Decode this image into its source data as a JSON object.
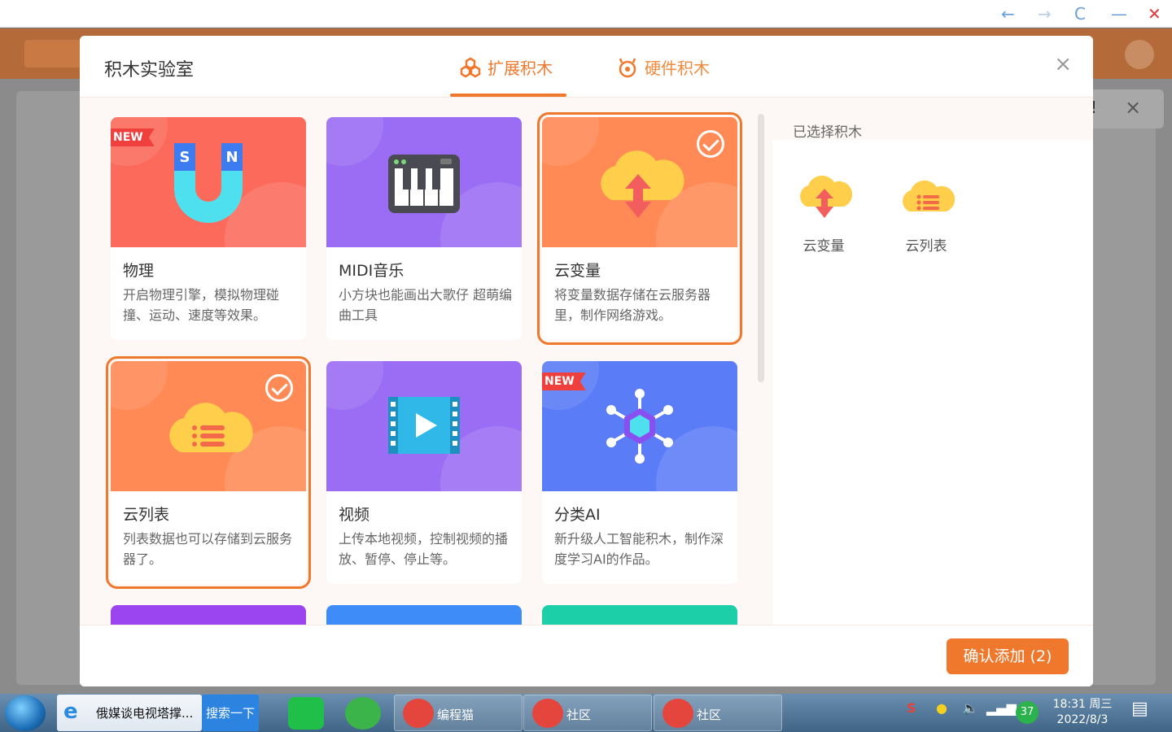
{
  "modal": {
    "title": "积木实验室",
    "tabs": [
      {
        "label": "扩展积木",
        "active": true
      },
      {
        "label": "硬件积木",
        "active": false
      }
    ],
    "close_icon": "×",
    "cards": [
      {
        "title": "物理",
        "desc": "开启物理引擎，模拟物理碰撞、运动、速度等效果。",
        "badge": "NEW",
        "selected": false,
        "color": "#fb6a5a",
        "icon": "magnet-icon"
      },
      {
        "title": "MIDI音乐",
        "desc": "小方块也能画出大歌仔 超萌编曲工具",
        "badge": "",
        "selected": false,
        "color": "#9b6cf4",
        "icon": "piano-icon"
      },
      {
        "title": "云变量",
        "desc": "将变量数据存储在云服务器里，制作网络游戏。",
        "badge": "",
        "selected": true,
        "color": "#ff8a55",
        "icon": "cloud-variable-icon"
      },
      {
        "title": "云列表",
        "desc": "列表数据也可以存储到云服务器了。",
        "badge": "",
        "selected": true,
        "color": "#ff8a55",
        "icon": "cloud-list-icon"
      },
      {
        "title": "视频",
        "desc": "上传本地视频，控制视频的播放、暂停、停止等。",
        "badge": "",
        "selected": false,
        "color": "#9b6cf4",
        "icon": "video-icon"
      },
      {
        "title": "分类AI",
        "desc": "新升级人工智能积木，制作深度学习AI的作品。",
        "badge": "NEW",
        "selected": false,
        "color": "#5a7cf7",
        "icon": "ai-icon"
      }
    ],
    "partial_cards": [
      "#9b45f0",
      "#3e8cf7",
      "#1ccfa8"
    ],
    "sidebar": {
      "heading": "已选择积木",
      "items": [
        {
          "label": "云变量",
          "icon": "cloud-variable-icon"
        },
        {
          "label": "云列表",
          "icon": "cloud-list-icon"
        }
      ]
    },
    "confirm_label": "确认添加 (2)"
  },
  "background": {
    "toast_text": "!",
    "toast_close": "×"
  },
  "browser": {
    "back": "←",
    "forward": "→",
    "refresh": "C",
    "minimize": "—",
    "close": "✕"
  },
  "taskbar": {
    "ie_label": "俄媒谈电视塔撑...",
    "search_label": "搜索一下",
    "apps": [
      {
        "label": "编程猫"
      },
      {
        "label": "社区"
      },
      {
        "label": "社区"
      }
    ],
    "badge": "37",
    "time": "18:31 周三",
    "date": "2022/8/3"
  }
}
